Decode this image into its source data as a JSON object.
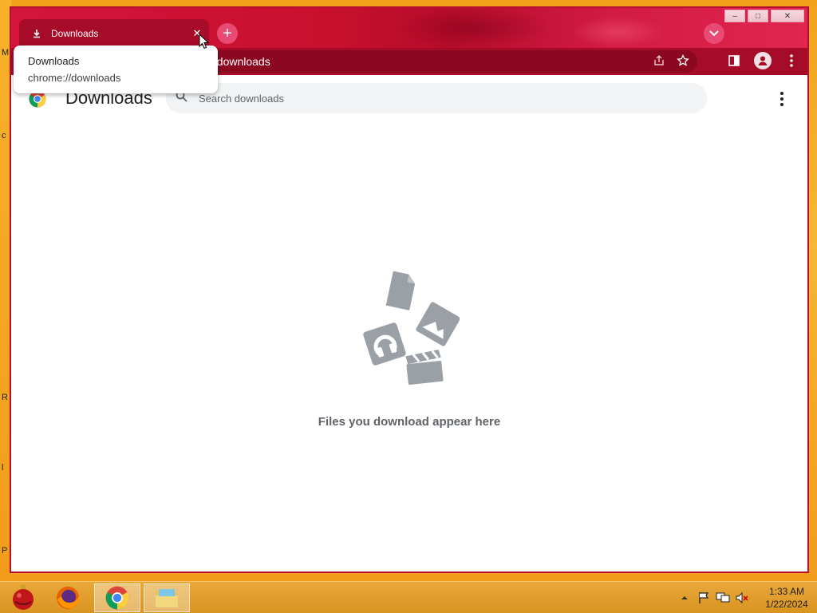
{
  "browser": {
    "tab": {
      "title": "Downloads",
      "close_glyph": "✕"
    },
    "new_tab_glyph": "+",
    "omnibox": {
      "url_visible": "//downloads"
    },
    "window_controls": {
      "minimize": "–",
      "maximize": "□",
      "close": "✕"
    }
  },
  "tooltip": {
    "title": "Downloads",
    "url": "chrome://downloads"
  },
  "page": {
    "title": "Downloads",
    "search": {
      "placeholder": "Search downloads",
      "value": ""
    },
    "empty_message": "Files you download appear here"
  },
  "taskbar": {
    "apps": [
      "ornament-app",
      "firefox",
      "chrome",
      "file-explorer"
    ],
    "clock": {
      "time": "1:33 AM",
      "date": "1/22/2024"
    }
  },
  "desktop": {
    "edge_letters": [
      "M",
      "c",
      "R",
      "l",
      "P"
    ]
  },
  "colors": {
    "frame": "#c8102e",
    "toolbar": "#a60b28",
    "accent_pink": "#e84a73",
    "empty_icon_gray": "#9aa0a6"
  }
}
